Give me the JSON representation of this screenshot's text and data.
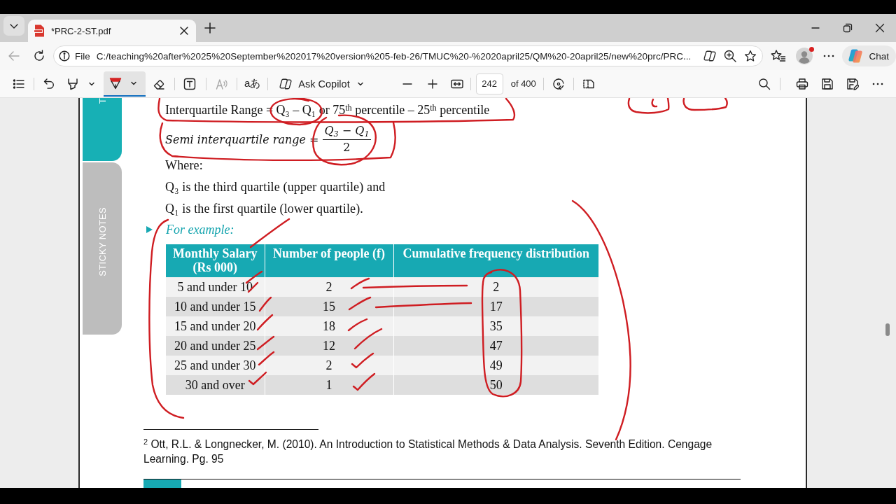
{
  "tabs": [
    {
      "title": "*PRC-2-ST.pdf",
      "selected": true
    }
  ],
  "navigation": {
    "back_disabled": true
  },
  "address_bar": {
    "scheme": "File",
    "url": "C:/teaching%20after%2025%20September%202017%20version%205-feb-26/TMUC%20-%2020april25/QM%20-20april25/new%20prc/PRC..."
  },
  "profile": {
    "has_notification": true
  },
  "chat_button": {
    "label": "Chat"
  },
  "pdf_toolbar": {
    "draw_tool": {
      "selected": true
    },
    "read_aloud": {
      "disabled": true
    },
    "translate_glyph": "aあ",
    "copilot_label": "Ask Copilot",
    "page_number": "242",
    "page_count": "of 400"
  },
  "side_tabs": [
    {
      "label": "T",
      "selected": true
    },
    {
      "label": "STICKY NOTES",
      "selected": false
    }
  ],
  "document": {
    "formula_1": "Interquartile Range = Q₃ – Q₁ or 75$^{th}$ percentile – 25$^{th}$ percentile",
    "formula_2": {
      "label": "Semi interquartile range =",
      "numerator": "Q$_{3}$ − Q$_{1}$",
      "denominator": "2"
    },
    "paragraphs": [
      "Where:",
      "Q₃ is the third quartile (upper quartile) and",
      "Q₁ is the first quartile (lower quartile)."
    ],
    "example_heading": "For example:",
    "table": {
      "columns": [
        "Monthly Salary (Rs 000)",
        "Number of people (f)",
        "Cumulative frequency distribution"
      ],
      "rows": [
        [
          "5 and under 10",
          "2",
          "2"
        ],
        [
          "10 and under 15",
          "15",
          "17"
        ],
        [
          "15 and under 20",
          "18",
          "35"
        ],
        [
          "20 and under 25",
          "12",
          "47"
        ],
        [
          "25 and under 30",
          "2",
          "49"
        ],
        [
          "30 and over",
          "1",
          "50"
        ]
      ]
    },
    "footnote": "$^{2}$ Ott, R.L. & Longnecker, M. (2010). An Introduction to Statistical Methods & Data Analysis. Seventh Edition. Cengage Learning. Pg. 95"
  }
}
